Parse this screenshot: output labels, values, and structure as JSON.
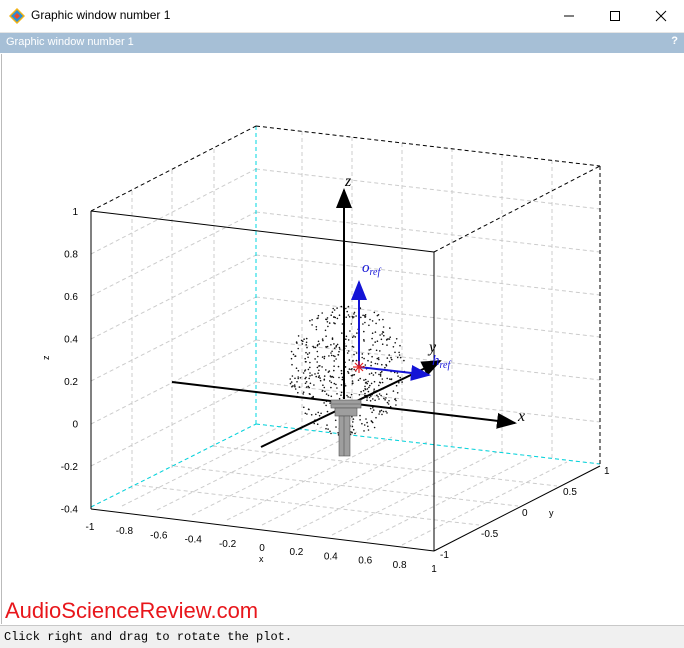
{
  "window": {
    "title": "Graphic window number 1",
    "subtitle": "Graphic window number 1",
    "help": "?"
  },
  "status": {
    "message": "Click right and drag to rotate the plot."
  },
  "watermark": "AudioScienceReview.com",
  "plot": {
    "type": "3d-scatter",
    "z_axis": {
      "label": "z",
      "ticks": [
        "1",
        "0.8",
        "0.6",
        "0.4",
        "0.2",
        "0",
        "-0.2",
        "-0.4"
      ],
      "range": [
        -0.4,
        1
      ]
    },
    "x_axis": {
      "label": "x",
      "ticks": [
        "-1",
        "-0.8",
        "-0.6",
        "-0.4",
        "-0.2",
        "0",
        "0.2",
        "0.4",
        "0.6",
        "0.8",
        "1"
      ],
      "range": [
        -1,
        1
      ]
    },
    "y_axis": {
      "label": "y",
      "ticks": [
        "-1",
        "-0.5",
        "0",
        "0.5",
        "1"
      ],
      "range": [
        -1,
        1
      ]
    },
    "vectors": {
      "axis_x": "x",
      "axis_y": "y",
      "axis_z": "z",
      "o_ref": "o",
      "o_ref_sub": "ref",
      "h_ref": "h",
      "h_ref_sub": "ref"
    },
    "colors": {
      "grid_dash": "#cccccc",
      "cyan_edge": "#00d7e0",
      "ref_vector": "#1414d6",
      "marker": "#e02020"
    }
  }
}
